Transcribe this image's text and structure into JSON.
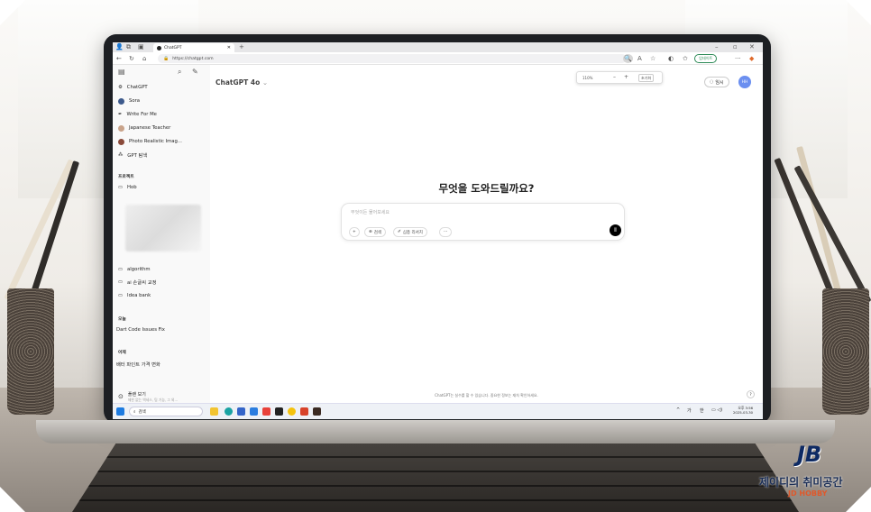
{
  "browser": {
    "tab_title": "ChatGPT",
    "url": "https://chatgpt.com",
    "zoom": "110%",
    "zoom_reset": "초기화",
    "update_button": "업데이트"
  },
  "sidebar": {
    "items": [
      {
        "label": "ChatGPT",
        "icon": "chatgpt-icon"
      },
      {
        "label": "Sora",
        "icon": "sora-icon"
      },
      {
        "label": "Write For Me",
        "icon": "pen-icon"
      },
      {
        "label": "Japanese Teacher",
        "icon": "teacher-icon"
      },
      {
        "label": "Photo Realistic Imag...",
        "icon": "photo-icon"
      },
      {
        "label": "GPT 탐색",
        "icon": "explore-icon"
      }
    ],
    "projects_heading": "프로젝트",
    "projects": [
      "Hob",
      "algorithm",
      "ai 손글씨 교정",
      "Idea bank"
    ],
    "today_heading": "오늘",
    "today": [
      "Dart Code Issues Fix"
    ],
    "yesterday_heading": "어제",
    "yesterday": [
      "배터 파인트 가격 변화"
    ],
    "upgrade": {
      "title": "플랜 보기",
      "subtitle": "제한 없는 액세스, 팀 기능, 그 외..."
    }
  },
  "header": {
    "model": "ChatGPT 4o",
    "temp_button": "임시",
    "avatar": "HH"
  },
  "main": {
    "greeting": "무엇을 도와드릴까요?",
    "placeholder": "무엇이든 물어보세요",
    "buttons": {
      "search": "검색",
      "deep_research": "심층 리서치",
      "more": "···"
    },
    "footer": "ChatGPT는 실수를 할 수 있습니다. 중요한 정보는 재차 확인하세요."
  },
  "taskbar": {
    "search": "검색",
    "ime1": "가",
    "ime2": "한",
    "time": "오후 3:56",
    "date": "2025-03-30"
  },
  "watermark": {
    "logo": "JB",
    "title": "제이디의 취미공간",
    "subtitle": "JD HOBBY"
  },
  "colors": {
    "accent": "#000000",
    "avatar_bg": "#6b8ff0",
    "update_green": "#2e8b57"
  }
}
